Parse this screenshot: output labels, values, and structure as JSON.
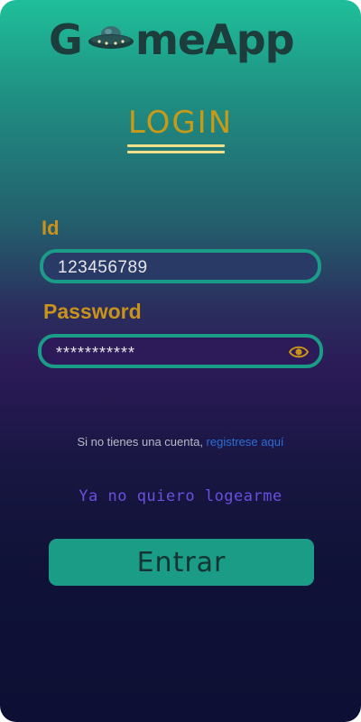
{
  "header": {
    "logo_prefix": "G",
    "logo_suffix": "meApp",
    "logo_icon": "ufo-icon"
  },
  "login": {
    "title": "LOGIN"
  },
  "form": {
    "id_label": "Id",
    "id_value": "123456789",
    "password_label": "Password",
    "password_value": "***********",
    "password_icon": "eye-icon"
  },
  "register": {
    "text": "Si no tienes una cuenta, ",
    "link": "registrese aquí"
  },
  "skip_login": "Ya no quiero logearme",
  "enter_button": "Entrar",
  "colors": {
    "gradient_top": "#1fbf9a",
    "gradient_mid": "#2b1a57",
    "gradient_bottom": "#0d1034",
    "accent_gold": "#c9921a",
    "field_border": "#1a9c86",
    "link_blue": "#2a6fd6",
    "skip_purple": "#6a4fe0",
    "button_fill": "#1a9c86"
  }
}
